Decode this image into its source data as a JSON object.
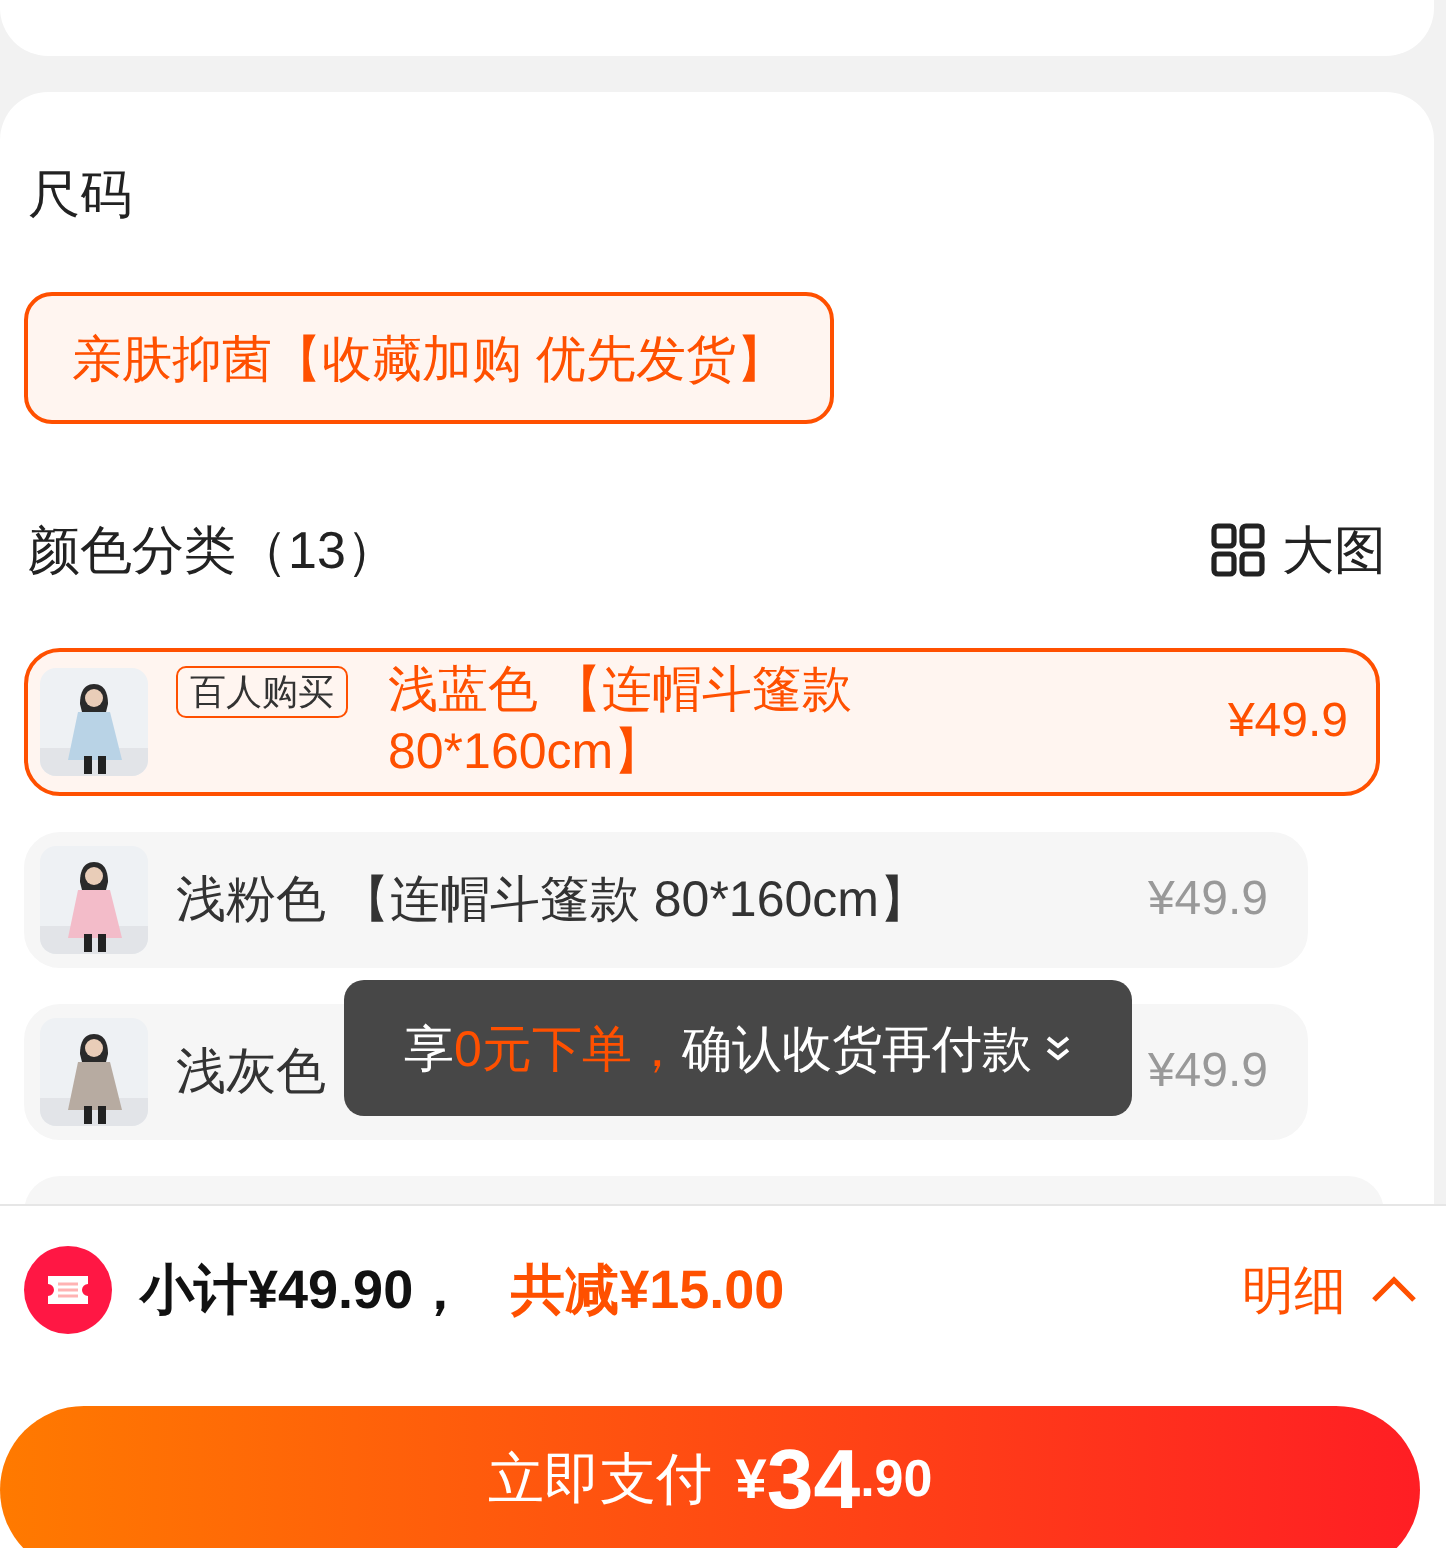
{
  "size_section": {
    "title": "尺码",
    "options": [
      {
        "label": "亲肤抑菌【收藏加购 优先发货】",
        "selected": true
      }
    ]
  },
  "color_section": {
    "title": "颜色分类（13）",
    "view_toggle": "大图",
    "options": [
      {
        "name": "浅蓝色 【连帽斗篷款 80*160cm】",
        "badge": "百人购买",
        "price": "¥49.9",
        "selected": true
      },
      {
        "name": "浅粉色 【连帽斗篷款 80*160cm】",
        "price": "¥49.9",
        "selected": false
      },
      {
        "name": "浅灰色",
        "price": "¥49.9",
        "selected": false
      }
    ]
  },
  "toast": {
    "segments": [
      {
        "text": "享",
        "highlight": false
      },
      {
        "text": "0元下单，",
        "highlight": true
      },
      {
        "text": "确认收货再付款",
        "highlight": false
      }
    ]
  },
  "summary": {
    "subtotal": "小计¥49.90，",
    "discount": "共减¥15.00",
    "details": "明细"
  },
  "pay_button": {
    "label": "立即支付",
    "currency": "¥",
    "amount": "34",
    "cents": ".90"
  }
}
